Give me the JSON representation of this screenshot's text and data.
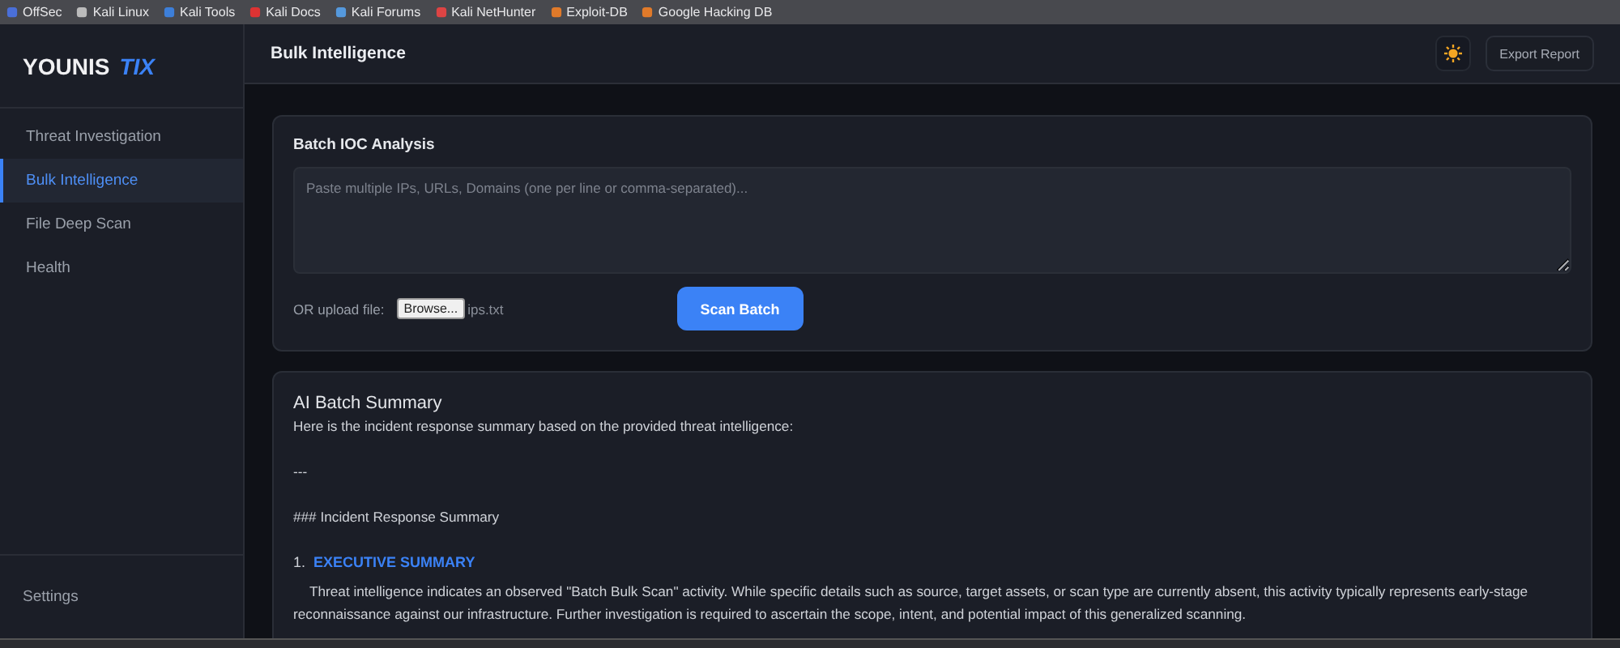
{
  "bookmarks": [
    {
      "label": "OffSec"
    },
    {
      "label": "Kali Linux"
    },
    {
      "label": "Kali Tools"
    },
    {
      "label": "Kali Docs"
    },
    {
      "label": "Kali Forums"
    },
    {
      "label": "Kali NetHunter"
    },
    {
      "label": "Exploit-DB"
    },
    {
      "label": "Google Hacking DB"
    }
  ],
  "sidebar": {
    "brand": "YOUNIS",
    "brand_accent": "TIX",
    "items": [
      {
        "label": "Threat Investigation",
        "selected": false
      },
      {
        "label": "Bulk Intelligence",
        "selected": true
      },
      {
        "label": "File Deep Scan",
        "selected": false
      },
      {
        "label": "Health",
        "selected": false
      }
    ],
    "footer": "Settings"
  },
  "header": {
    "title": "Bulk Intelligence",
    "export_button": "Export Report"
  },
  "batch": {
    "title": "Batch IOC Analysis",
    "placeholder": "Paste multiple IPs, URLs, Domains (one per line or comma-separated)...",
    "upload_label": "OR upload file:",
    "browse_button": "Browse...",
    "file_name": "ips.txt",
    "scan_button": "Scan Batch"
  },
  "summary": {
    "title": "AI Batch Summary",
    "lines": [
      "Here is the incident response summary based on the provided threat intelligence:",
      "---",
      "### Incident Response Summary"
    ],
    "items": [
      {
        "number": "1.",
        "heading": "EXECUTIVE SUMMARY",
        "body": "Threat intelligence indicates an observed \"Batch Bulk Scan\" activity. While specific details such as source, target assets, or scan type are currently absent, this activity typically represents early-stage reconnaissance against our infrastructure. Further investigation is required to ascertain the scope, intent, and potential impact of this generalized scanning."
      }
    ]
  }
}
